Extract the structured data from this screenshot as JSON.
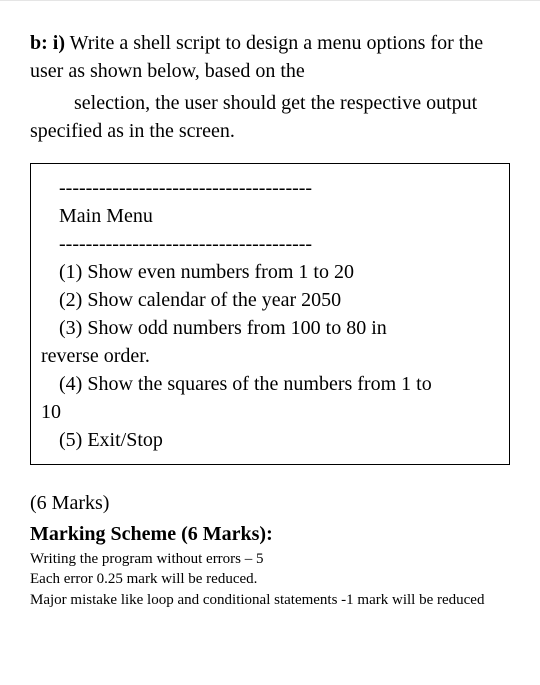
{
  "question": {
    "label": "b: i)",
    "text_part1": " Write a shell script to design a menu options for the user as shown below, based on the",
    "text_part2": "selection, the user should get the respective output specified as in the screen."
  },
  "menu": {
    "separator1": "--------------------------------------",
    "title": "Main Menu",
    "separator2": "--------------------------------------",
    "item1": "(1) Show even numbers from 1 to 20",
    "item2": "(2) Show calendar of the year 2050",
    "item3a": "(3) Show odd numbers from 100 to 80 in",
    "item3b": "reverse order.",
    "item4a": "(4) Show the squares of the numbers from 1 to",
    "item4b": "10",
    "item5": "(5) Exit/Stop"
  },
  "marks": {
    "total": "(6 Marks)",
    "scheme_title": "Marking Scheme (6 Marks):",
    "line1": "Writing the program without errors – 5",
    "line2": "Each error   0.25 mark will be reduced.",
    "line3": "Major mistake like loop and conditional statements -1 mark will be reduced"
  }
}
